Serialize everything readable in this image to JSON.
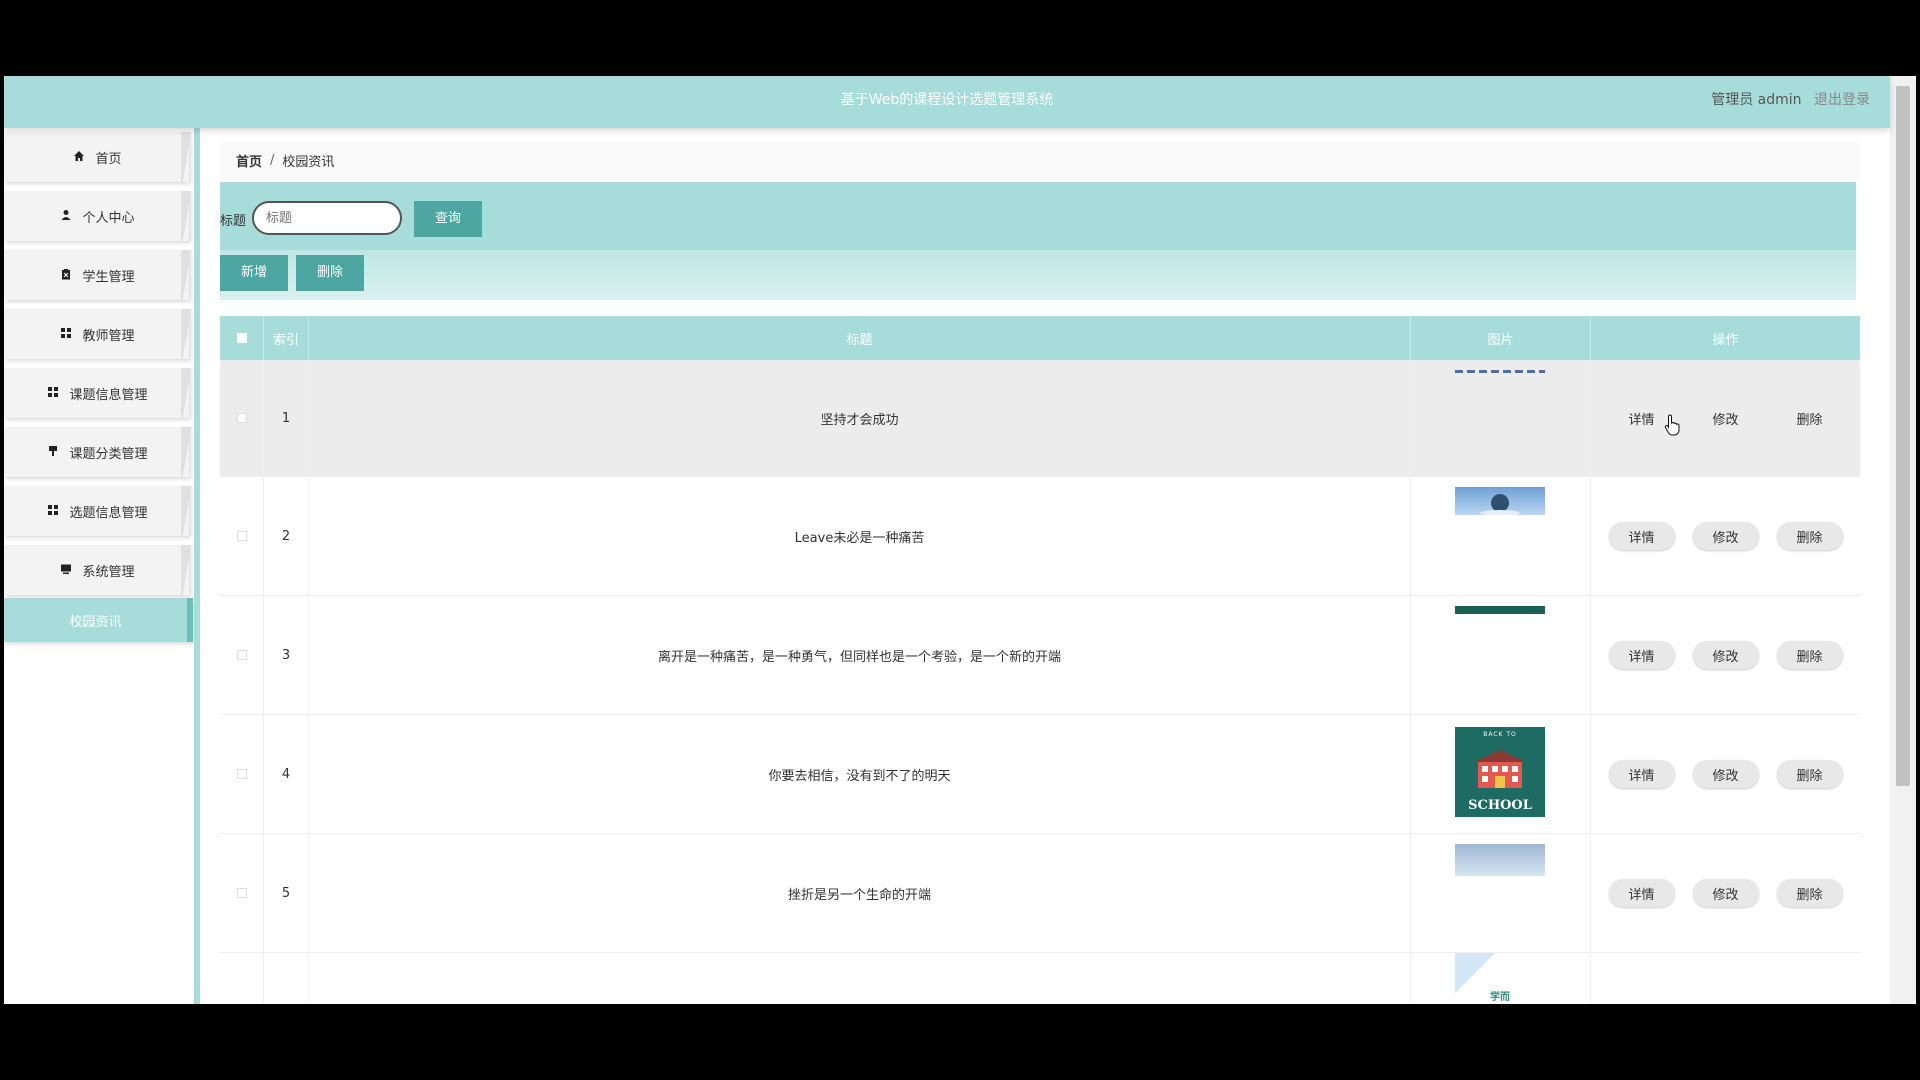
{
  "app": {
    "title": "基于Web的课程设计选题管理系统",
    "user_label": "管理员 admin",
    "logout_label": "退出登录"
  },
  "colors": {
    "accent": "#a6dcd9",
    "button_dark": "#4ea6a2"
  },
  "sidebar": {
    "items": [
      {
        "label": "首页",
        "icon": "home-icon"
      },
      {
        "label": "个人中心",
        "icon": "user-icon"
      },
      {
        "label": "学生管理",
        "icon": "clipboard-icon"
      },
      {
        "label": "教师管理",
        "icon": "grid-icon"
      },
      {
        "label": "课题信息管理",
        "icon": "grid-icon"
      },
      {
        "label": "课题分类管理",
        "icon": "pin-icon"
      },
      {
        "label": "选题信息管理",
        "icon": "grid-icon"
      },
      {
        "label": "系统管理",
        "icon": "monitor-icon"
      }
    ],
    "active_label": "校园资讯"
  },
  "breadcrumb": {
    "home": "首页",
    "separator": "/",
    "current": "校园资讯"
  },
  "search": {
    "label": "标题",
    "placeholder": "标题",
    "button": "查询"
  },
  "actions": {
    "add": "新增",
    "delete": "删除"
  },
  "table": {
    "headers": {
      "index": "索引",
      "title": "标题",
      "image": "图片",
      "operations": "操作"
    },
    "op_labels": {
      "detail": "详情",
      "edit": "修改",
      "delete": "删除"
    },
    "rows": [
      {
        "index": "1",
        "title": "坚持才会成功"
      },
      {
        "index": "2",
        "title": "Leave未必是一种痛苦"
      },
      {
        "index": "3",
        "title": "离开是一种痛苦，是一种勇气，但同样也是一个考验，是一个新的开端"
      },
      {
        "index": "4",
        "title": "你要去相信，没有到不了的明天"
      },
      {
        "index": "5",
        "title": "挫折是另一个生命的开端"
      }
    ],
    "thumb_texts": {
      "row4_top": "BACK TO",
      "row4_bottom": "SCHOOL",
      "row6": "学而"
    }
  }
}
